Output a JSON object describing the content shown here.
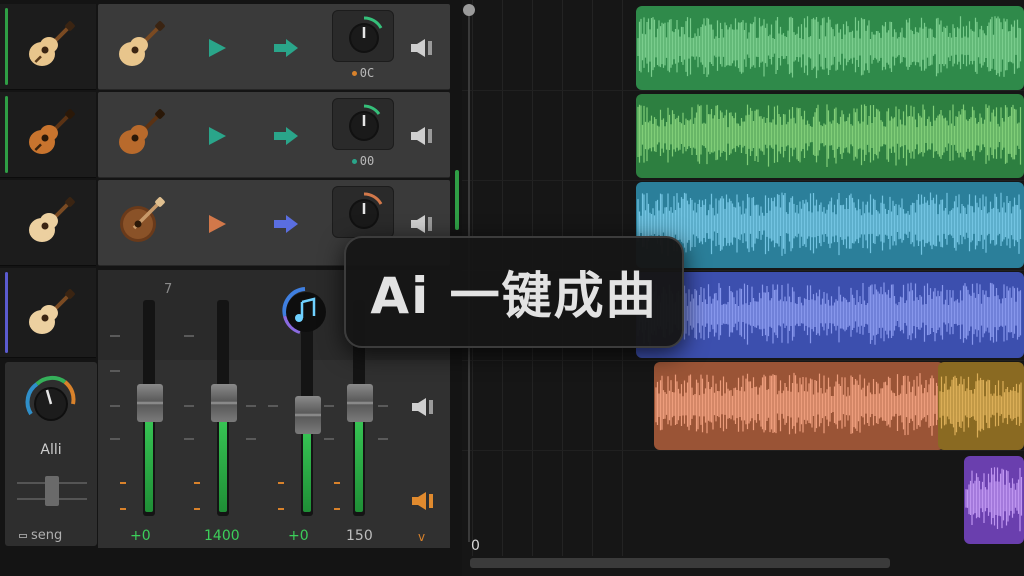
{
  "tracks": [
    {
      "stripe_color": "#2f9e45",
      "guitar_tone": "light",
      "play_color": "#2aa58a",
      "arrow_color": "#2aa58a",
      "knob_arc": "#35c07a",
      "knob_value": "0C",
      "dot_color": "#d9822b"
    },
    {
      "stripe_color": "#2f9e45",
      "guitar_tone": "dark",
      "play_color": "#2aa58a",
      "arrow_color": "#2aa58a",
      "knob_arc": "#35c07a",
      "knob_value": "00",
      "dot_color": "#2aa58a"
    },
    {
      "stripe_color": "#1e1e1e",
      "guitar_tone": "round",
      "play_color": "#d2784a",
      "arrow_color": "#5a6ee0",
      "knob_arc": "#d2784a",
      "knob_value": "",
      "dot_color": "#5a6ee0"
    },
    {
      "stripe_color": "#5b5bd0",
      "guitar_tone": "light"
    }
  ],
  "mixer": {
    "knob_label": "Alli",
    "song_label": "seng",
    "channel_number": "7",
    "music_knob_icon": "music-note-icon",
    "channels": [
      {
        "value": "+0",
        "level": 0.52
      },
      {
        "value": "1400",
        "level": 0.52
      },
      {
        "value": "+0",
        "level": 0.46
      },
      {
        "value": "150",
        "level": 0.52
      }
    ],
    "chevron": "v"
  },
  "timeline": {
    "ruler_start": "0",
    "clips": [
      {
        "color": "#2f8a4a",
        "wave": "#7fd191"
      },
      {
        "color": "#2d7f40",
        "wave": "#86d37c"
      },
      {
        "color": "#2b7f9a",
        "wave": "#78c9e6"
      },
      {
        "color": "#3c4fae",
        "wave": "#8c9bf0"
      },
      {
        "color": "#9a5436",
        "wave": "#f2a180"
      },
      {
        "color": "#8a6a22",
        "wave": "#e0b25a"
      },
      {
        "color": "#6a3fae",
        "wave": "#c39af4"
      }
    ]
  },
  "popup": {
    "text": "Ai 一键成曲"
  }
}
